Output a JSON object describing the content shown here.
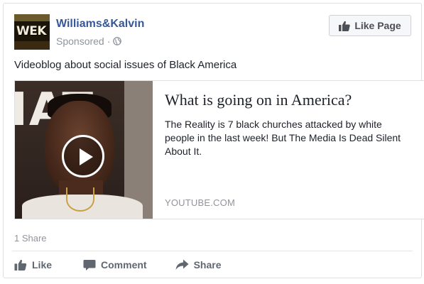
{
  "post": {
    "page_name": "Williams&Kalvin",
    "sponsored_label": "Sponsored",
    "meta_separator": "·",
    "avatar_text": "WEK",
    "like_page_label": "Like Page",
    "text": "Videoblog about social issues of Black America"
  },
  "link_preview": {
    "title": "What is going on in America?",
    "description": "The Reality is 7 black churches attacked by white people in the last week! But The Media Is Dead Silent About It.",
    "domain": "YOUTUBE.COM"
  },
  "stats": {
    "shares": "1 Share"
  },
  "actions": {
    "like": "Like",
    "comment": "Comment",
    "share": "Share"
  },
  "icons": {
    "like_page": "thumbs-up-icon",
    "globe": "globe-icon",
    "play": "play-icon",
    "like": "thumbs-up-icon",
    "comment": "speech-bubble-icon",
    "share": "share-arrow-icon"
  },
  "colors": {
    "link_blue": "#365899",
    "muted_gray": "#90949c",
    "action_gray": "#606770",
    "border": "#dddfe2"
  }
}
